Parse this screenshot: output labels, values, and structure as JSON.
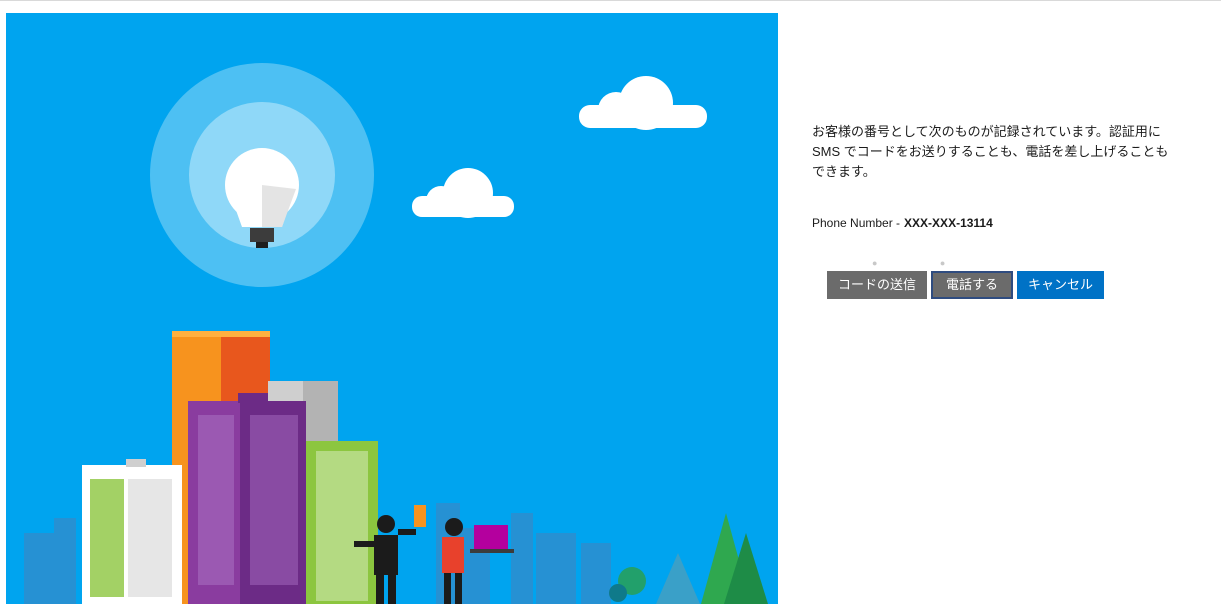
{
  "colors": {
    "sky": "#00a4ef",
    "accent_blue": "#0072c6",
    "button_gray": "#6b6b6b"
  },
  "hero": {
    "icon": "lightbulb-icon",
    "illustration": "city-skyline-with-people"
  },
  "verify": {
    "message": "お客様の番号として次のものが記録されています。認証用に SMS でコードをお送りすることも、電話を差し上げることもできます。",
    "phone_label": "Phone Number -",
    "phone_value": "XXX-XXX-13114",
    "send_code_label": "コードの送信",
    "call_label": "電話する",
    "cancel_label": "キャンセル"
  }
}
